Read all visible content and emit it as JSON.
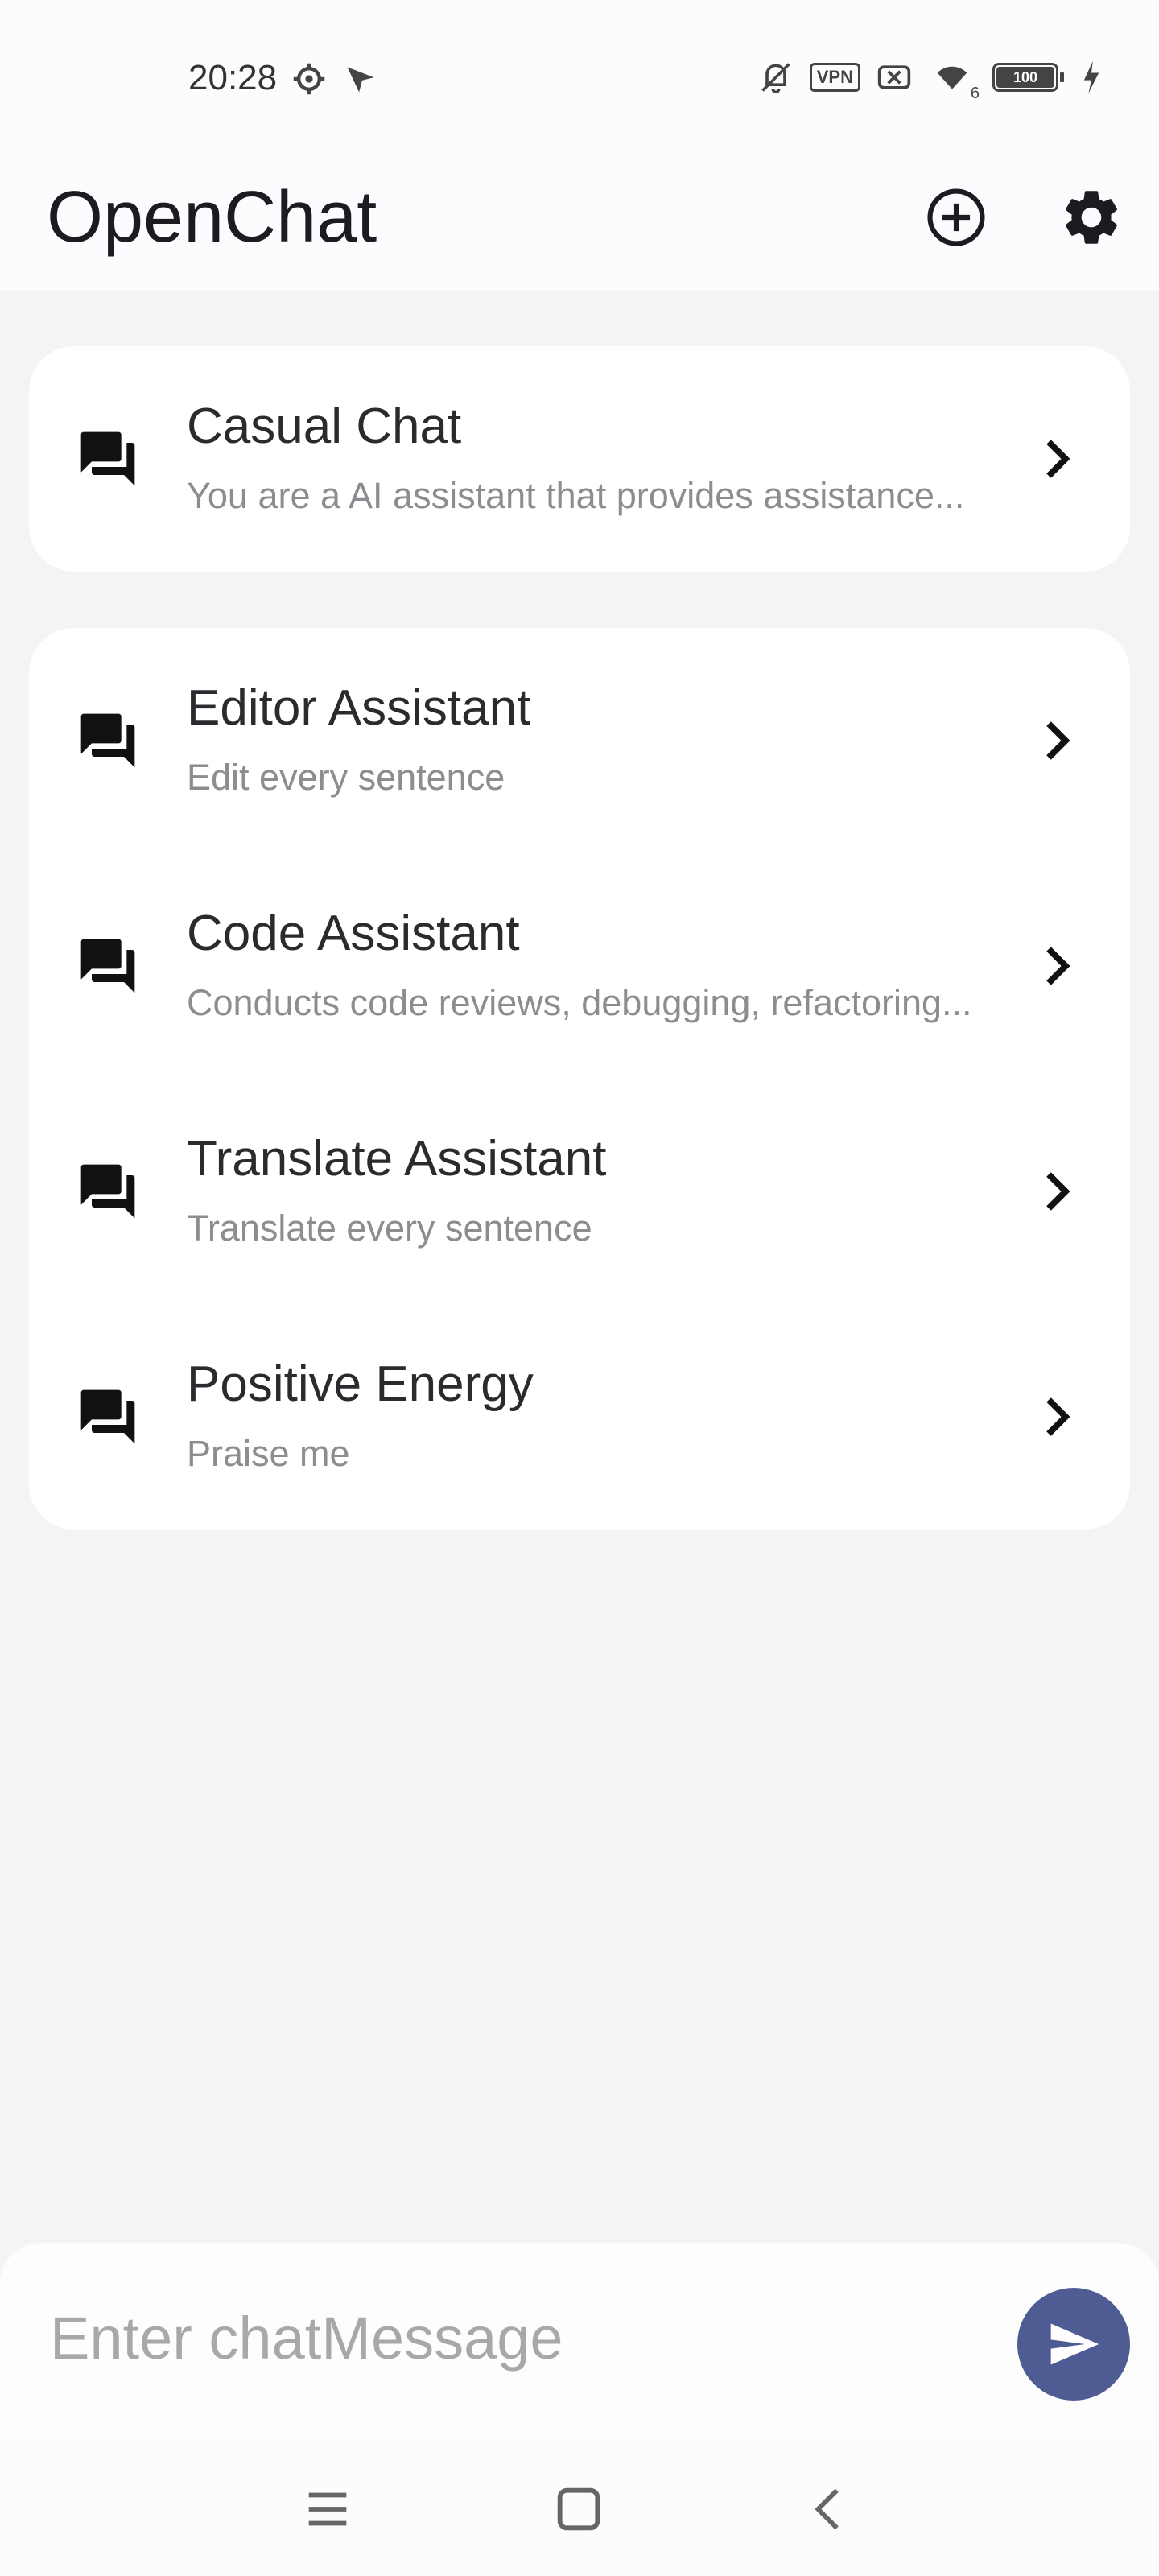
{
  "status_bar": {
    "time": "20:28",
    "left_icons": [
      "settings-gear-icon",
      "location-arrow-icon"
    ],
    "right_icons": [
      "mute-icon",
      "vpn-icon",
      "no-sim-icon",
      "wifi-icon",
      "battery-icon",
      "charging-icon"
    ],
    "vpn_label": "VPN",
    "wifi_badge": "6",
    "battery_level": "100"
  },
  "app_bar": {
    "title": "OpenChat",
    "actions": [
      "add-circle-icon",
      "settings-icon"
    ]
  },
  "chats": {
    "pinned": [
      {
        "title": "Casual Chat",
        "subtitle": "You are a AI assistant that provides assistance..."
      }
    ],
    "assistants": [
      {
        "title": "Editor Assistant",
        "subtitle": "Edit every sentence"
      },
      {
        "title": "Code Assistant",
        "subtitle": "Conducts code reviews, debugging, refactoring..."
      },
      {
        "title": "Translate Assistant",
        "subtitle": "Translate every sentence"
      },
      {
        "title": "Positive Energy",
        "subtitle": "Praise me"
      }
    ]
  },
  "composer": {
    "placeholder": "Enter chatMessage",
    "send_icon": "send-icon"
  },
  "nav_bar": {
    "buttons": [
      "menu-icon",
      "home-icon",
      "back-icon"
    ]
  },
  "colors": {
    "accent": "#4f5b93",
    "background": "#f4f4f6",
    "card": "#ffffff"
  }
}
